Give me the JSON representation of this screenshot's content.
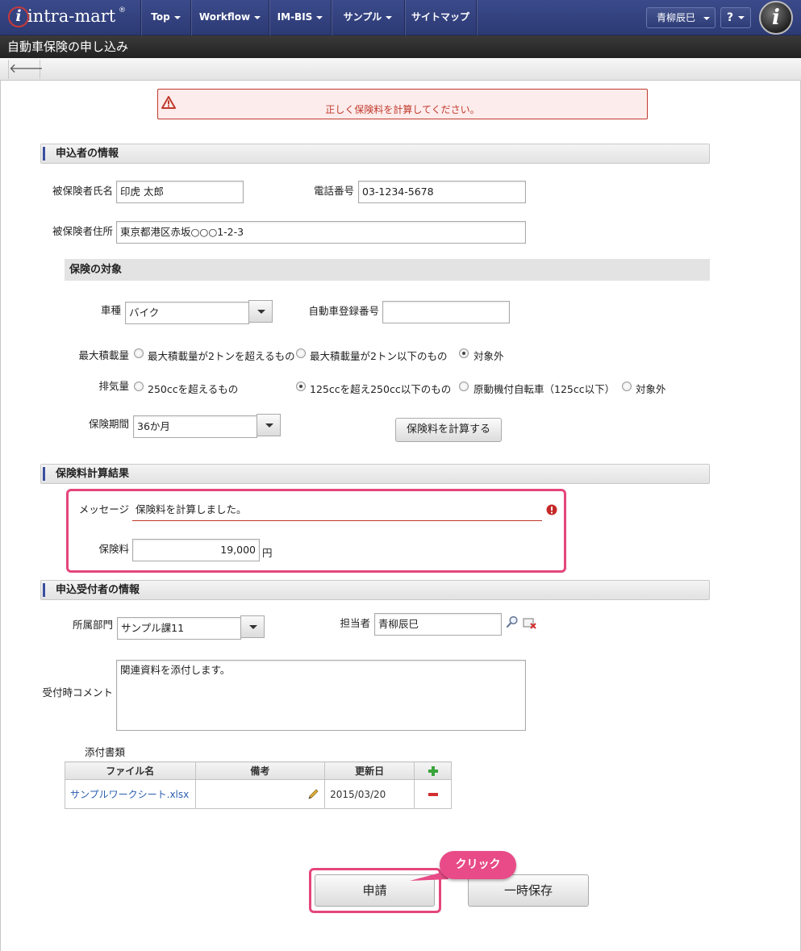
{
  "nav": {
    "logo": "intra-mart",
    "items": [
      {
        "label": "Top"
      },
      {
        "label": "Workflow"
      },
      {
        "label": "IM-BIS"
      },
      {
        "label": "サンプル"
      },
      {
        "label": "サイトマップ"
      }
    ],
    "user": "青柳辰巳",
    "help": "?"
  },
  "page": {
    "title": "自動車保険の申し込み"
  },
  "error_banner": {
    "message": "正しく保険料を計算してください。"
  },
  "applicant": {
    "header": "申込者の情報",
    "name_label": "被保険者氏名",
    "name_value": "印虎 太郎",
    "phone_label": "電話番号",
    "phone_value": "03-1234-5678",
    "address_label": "被保険者住所",
    "address_value": "東京都港区赤坂○○○1-2-3"
  },
  "insurance_target": {
    "header": "保険の対象",
    "vehicle_label": "車種",
    "vehicle_value": "バイク",
    "reg_label": "自動車登録番号",
    "reg_value": "",
    "load_label": "最大積載量",
    "load_options": [
      "最大積載量が2トンを超えるもの",
      "最大積載量が2トン以下のもの",
      "対象外"
    ],
    "load_selected": 2,
    "disp_label": "排気量",
    "disp_options": [
      "250ccを超えるもの",
      "125ccを超え250cc以下のもの",
      "原動機付自転車（125cc以下）",
      "対象外"
    ],
    "disp_selected": 1,
    "period_label": "保険期間",
    "period_value": "36か月",
    "calc_button": "保険料を計算する"
  },
  "result": {
    "header": "保険料計算結果",
    "message_label": "メッセージ",
    "message_value": "保険料を計算しました。",
    "premium_label": "保険料",
    "premium_value": "19,000",
    "premium_unit": "円"
  },
  "receiver": {
    "header": "申込受付者の情報",
    "dept_label": "所属部門",
    "dept_value": "サンプル課11",
    "person_label": "担当者",
    "person_value": "青柳辰巳",
    "comment_label": "受付時コメント",
    "comment_value": "関連資料を添付します。",
    "attach_label": "添付書類",
    "table_headers": [
      "ファイル名",
      "備考",
      "更新日"
    ],
    "rows": [
      {
        "file": "サンプルワークシート.xlsx",
        "note": "",
        "date": "2015/03/20"
      }
    ]
  },
  "actions": {
    "apply": "申請",
    "save": "一時保存",
    "callout": "クリック"
  },
  "colors": {
    "nav_bg": "#2c3a74",
    "error": "#c0392b",
    "highlight": "#e4467c",
    "section_accent": "#3a4fa0"
  }
}
